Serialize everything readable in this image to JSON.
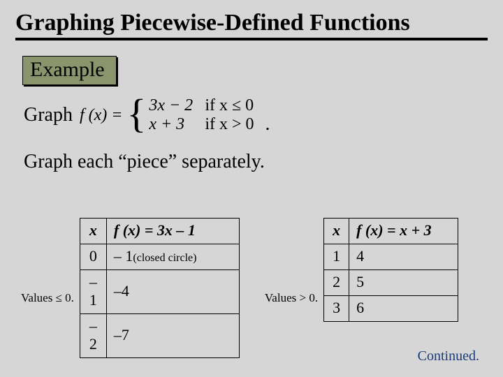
{
  "title": "Graphing Piecewise-Defined Functions",
  "example_label": "Example",
  "graph_word": "Graph",
  "piecewise_fx": "f (x) =",
  "piecewise": {
    "row1_expr": "3x − 2",
    "row1_cond": "if x ≤ 0",
    "row2_expr": "x + 3",
    "row2_cond": "if x > 0"
  },
  "period": ".",
  "hint": "Graph each “piece” separately.",
  "left_side_label": "Values ≤ 0.",
  "right_side_label": "Values > 0.",
  "table1": {
    "hx": "x",
    "hf_before": "f (x) = 3x – 1",
    "rows": [
      {
        "x": "0",
        "fx": "– 1",
        "note": "(closed circle)"
      },
      {
        "x": "–1",
        "fx": "–4",
        "note": ""
      },
      {
        "x": "–2",
        "fx": "–7",
        "note": ""
      }
    ]
  },
  "table2": {
    "hx": "x",
    "hf": "f (x) = x + 3",
    "rows": [
      {
        "x": "1",
        "fx": "4"
      },
      {
        "x": "2",
        "fx": "5"
      },
      {
        "x": "3",
        "fx": "6"
      }
    ]
  },
  "continued": "Continued."
}
